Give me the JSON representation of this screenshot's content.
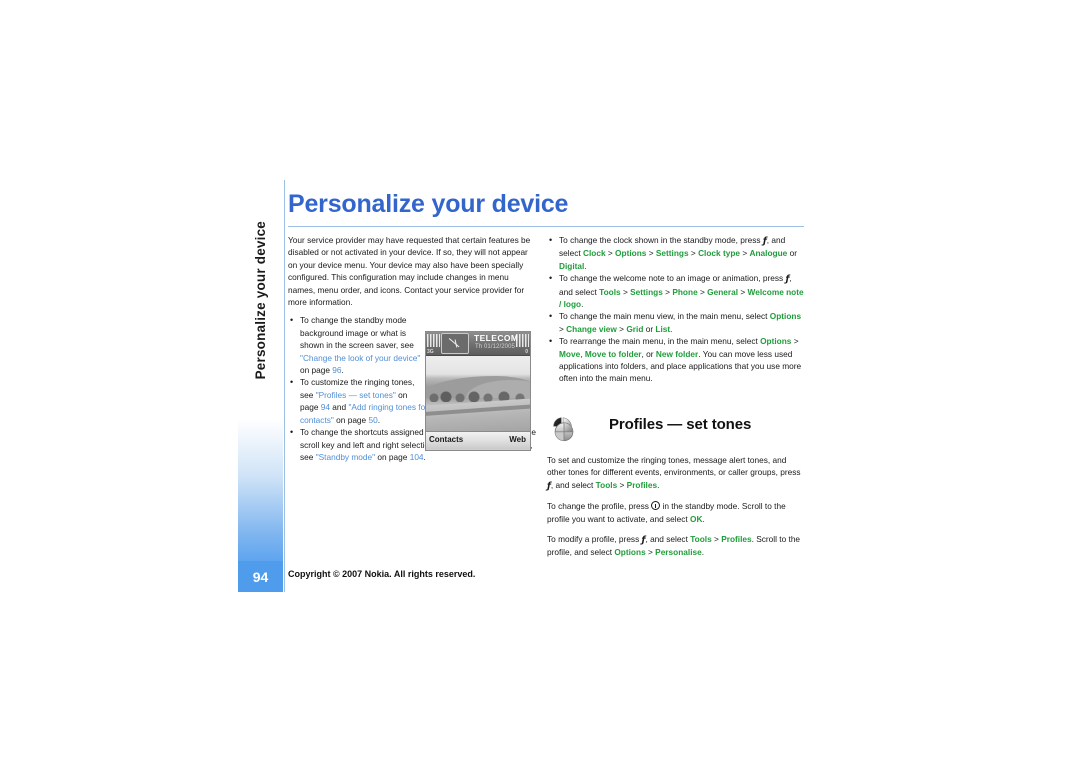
{
  "side_tab": {
    "label": "Personalize your device",
    "page_number": "94"
  },
  "title": "Personalize your device",
  "intro": "Your service provider may have requested that certain features be disabled or not activated in your device. If so, they will not appear on your device menu. Your device may also have been specially configured. This configuration may include changes in menu names, menu order, and icons. Contact your service provider for more information.",
  "left_bullets": {
    "b1": {
      "t1": "To change the standby mode background image or what is shown in the screen saver, see ",
      "link1": "\"Change the look of your device\"",
      "t2": " on page ",
      "link2": "96",
      "t3": "."
    },
    "b2": {
      "t1": "To customize the ringing tones, see ",
      "link1": "\"Profiles — set tones\"",
      "t2": " on page ",
      "link2": "94",
      "t3": " and ",
      "link3": "\"Add ringing tones for contacts\"",
      "t4": " on page ",
      "link4": "50",
      "t5": "."
    },
    "b3": {
      "t1": "To change the shortcuts assigned for the different presses of the scroll key and left and right selection keys in the standby mode, see ",
      "link1": "\"Standby mode\"",
      "t2": " on page ",
      "link2": "104",
      "t3": "."
    }
  },
  "right_bullets": {
    "b1": {
      "t1": "To change the clock shown in the standby mode, press ",
      "key": "menu-key",
      "t2": ", and select ",
      "m1": "Clock",
      "s1": " > ",
      "m2": "Options",
      "s2": " > ",
      "m3": "Settings",
      "s3": " > ",
      "m4": "Clock type",
      "s4": " > ",
      "m5": "Analogue",
      "t3": " or ",
      "m6": "Digital",
      "t4": "."
    },
    "b2": {
      "t1": "To change the welcome note to an image or animation, press ",
      "key": "menu-key",
      "t2": ", and select ",
      "m1": "Tools",
      "s1": " > ",
      "m2": "Settings",
      "s2": " > ",
      "m3": "Phone",
      "s3": " > ",
      "m4": "General",
      "s4": " > ",
      "m5": "Welcome note / logo",
      "t3": "."
    },
    "b3": {
      "t1": "To change the main menu view, in the main menu, select ",
      "m1": "Options",
      "s1": " > ",
      "m2": "Change view",
      "s2": " > ",
      "m3": "Grid",
      "t2": " or ",
      "m4": "List",
      "t3": "."
    },
    "b4": {
      "t1": "To rearrange the main menu, in the main menu, select ",
      "m1": "Options",
      "s1": " > ",
      "m2": "Move",
      "t2": ", ",
      "m3": "Move to folder",
      "t3": ", or ",
      "m4": "New folder",
      "t4": ". You can move less used applications into folders, and place applications that you use more often into the main menu."
    }
  },
  "section": {
    "icon": "profiles-icon",
    "title": "Profiles — set tones",
    "p1": {
      "t1": "To set and customize the ringing tones, message alert tones, and other tones for different events, environments, or caller groups, press ",
      "key": "menu-key",
      "t2": ", and select ",
      "m1": "Tools",
      "s1": " > ",
      "m2": "Profiles",
      "t3": "."
    },
    "p2": {
      "t1": "To change the profile, press ",
      "key": "power-key",
      "t2": " in the standby mode. Scroll to the profile you want to activate, and select ",
      "m1": "OK",
      "t3": "."
    },
    "p3": {
      "t1": "To modify a profile, press ",
      "key": "menu-key",
      "t2": ", and select ",
      "m1": "Tools",
      "s1": " > ",
      "m2": "Profiles",
      "t3": ". Scroll to the profile, and select ",
      "m3": "Options",
      "s2": " > ",
      "m4": "Personalise",
      "t4": "."
    }
  },
  "phone_screenshot": {
    "operator": "TELECOM",
    "datestamp": "Th 01/12/2005",
    "network": "3G",
    "battery": "0",
    "softkey_left": "Contacts",
    "softkey_right": "Web"
  },
  "footer": "Copyright © 2007 Nokia. All rights reserved.",
  "colors": {
    "title_blue": "#3366cc",
    "link_blue": "#4f8fd6",
    "menu_green": "#1f9d3a",
    "tab_blue": "#4f9ced"
  }
}
